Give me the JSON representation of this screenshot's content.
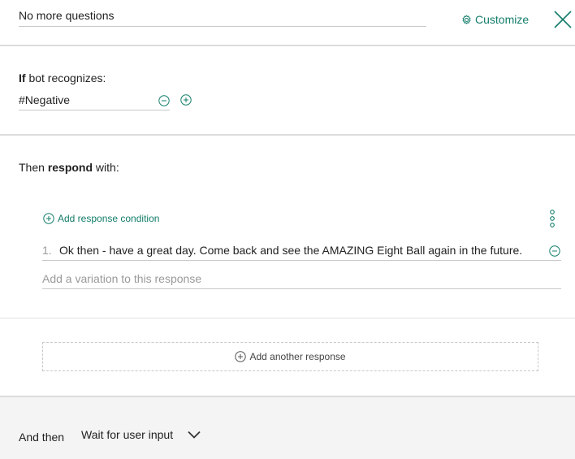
{
  "header": {
    "node_name": "No more questions",
    "customize_label": "Customize"
  },
  "condition": {
    "label_bold": "If",
    "label_rest": " bot recognizes:",
    "value": "#Negative"
  },
  "response": {
    "label_pre": "Then ",
    "label_bold": "respond",
    "label_post": " with:",
    "add_condition_label": "Add response condition",
    "items": [
      {
        "number": "1.",
        "text": "Ok then - have a great day.  Come back and see the AMAZING Eight Ball again in the future."
      }
    ],
    "variation_placeholder": "Add a variation to this response",
    "add_another_label": "Add another response"
  },
  "footer": {
    "and_then_label": "And then",
    "selected_action": "Wait for user input"
  },
  "colors": {
    "accent": "#137d6a"
  }
}
